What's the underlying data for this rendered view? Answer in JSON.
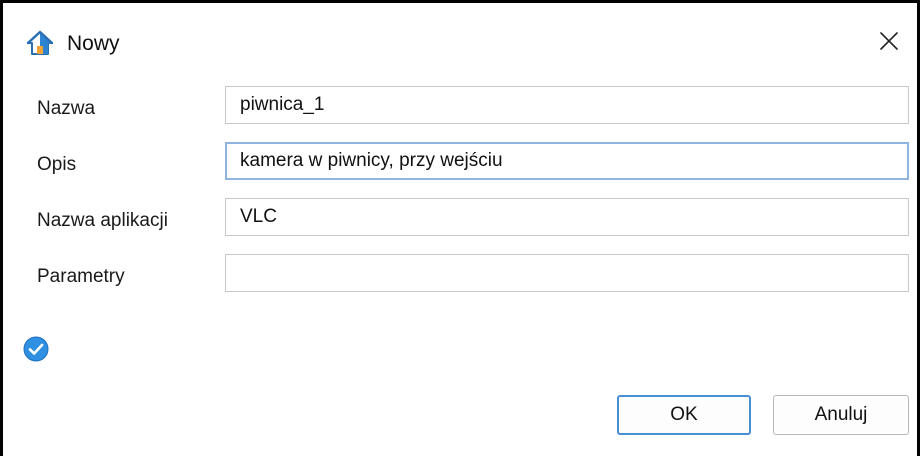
{
  "dialog": {
    "title": "Nowy",
    "title_icon": "home-icon",
    "close_icon": "close-icon"
  },
  "form": {
    "name_label": "Nazwa",
    "name_value": "piwnica_1",
    "description_label": "Opis",
    "description_value": "kamera w piwnicy, przy wejściu",
    "app_label": "Nazwa aplikacji",
    "app_value": "VLC",
    "params_label": "Parametry",
    "params_value": ""
  },
  "status": {
    "icon": "check-circle-icon",
    "color": "#2f8fe0"
  },
  "buttons": {
    "ok_label": "OK",
    "cancel_label": "Anuluj"
  },
  "colors": {
    "accent": "#4a8fd6",
    "focus_border": "#8fb4dd"
  }
}
